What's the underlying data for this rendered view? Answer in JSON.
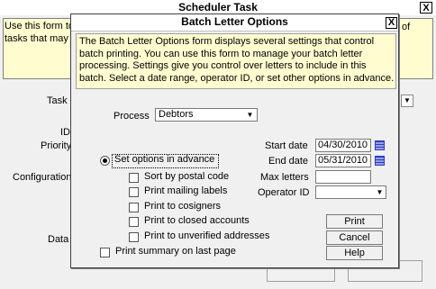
{
  "background_window": {
    "title": "Scheduler Task",
    "close_label": "X",
    "help_text_left": "Use this form to tasks that may",
    "help_text_right": "of",
    "labels": {
      "task": "Task",
      "id": "ID",
      "priority": "Priority",
      "configuration": "Configuration",
      "data": "Data"
    }
  },
  "dialog": {
    "title": "Batch Letter Options",
    "close_label": "X",
    "help_text": "The Batch Letter Options form displays several settings that control batch printing. You can use this form to manage your batch letter processing. Settings give you control over letters to include in this batch. Select a date range, operator ID, or set other options in advance.",
    "process": {
      "label": "Process",
      "value": "Debtors"
    },
    "start_date": {
      "label": "Start date",
      "value": "04/30/2010"
    },
    "end_date": {
      "label": "End date",
      "value": "05/31/2010"
    },
    "max_letters": {
      "label": "Max letters",
      "value": ""
    },
    "operator_id": {
      "label": "Operator ID",
      "value": ""
    },
    "set_options_radio": {
      "label": "Set options in advance",
      "selected": true
    },
    "options": [
      {
        "label": "Sort by postal code",
        "checked": false
      },
      {
        "label": "Print mailing labels",
        "checked": false
      },
      {
        "label": "Print to cosigners",
        "checked": false
      },
      {
        "label": "Print to closed accounts",
        "checked": false
      },
      {
        "label": "Print to unverified addresses",
        "checked": false
      }
    ],
    "print_summary": {
      "label": "Print summary on last page",
      "checked": false
    },
    "buttons": {
      "print": "Print",
      "cancel": "Cancel",
      "help": "Help"
    }
  }
}
